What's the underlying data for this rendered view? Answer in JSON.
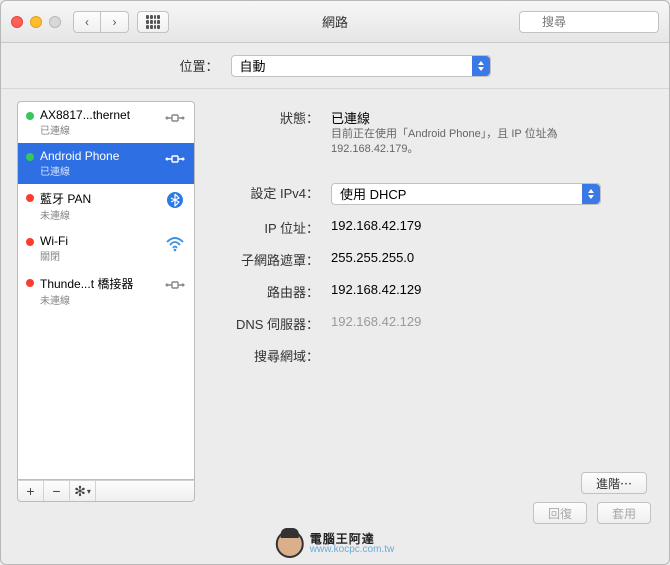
{
  "window": {
    "title": "網路"
  },
  "toolbar": {
    "search_placeholder": "搜尋"
  },
  "location": {
    "label": "位置：",
    "value": "自動"
  },
  "sidebar": {
    "items": [
      {
        "name": "AX8817...thernet",
        "status": "已連線",
        "dot": "green",
        "icon": "link"
      },
      {
        "name": "Android Phone",
        "status": "已連線",
        "dot": "green",
        "icon": "link"
      },
      {
        "name": "藍牙 PAN",
        "status": "未連線",
        "dot": "red",
        "icon": "bluetooth"
      },
      {
        "name": "Wi-Fi",
        "status": "關閉",
        "dot": "red",
        "icon": "wifi"
      },
      {
        "name": "Thunde...t 橋接器",
        "status": "未連線",
        "dot": "red",
        "icon": "link"
      }
    ],
    "buttons": {
      "add": "+",
      "remove": "−",
      "gear": "✻"
    }
  },
  "detail": {
    "status_label": "狀態：",
    "status_value": "已連線",
    "status_desc": "目前正在使用「Android Phone」，且 IP 位址為 192.168.42.179。",
    "ipv4_label": "設定 IPv4：",
    "ipv4_value": "使用 DHCP",
    "ip_label": "IP 位址：",
    "ip_value": "192.168.42.179",
    "mask_label": "子網路遮罩：",
    "mask_value": "255.255.255.0",
    "router_label": "路由器：",
    "router_value": "192.168.42.129",
    "dns_label": "DNS 伺服器：",
    "dns_value": "192.168.42.129",
    "search_label": "搜尋網域："
  },
  "buttons": {
    "advanced": "進階⋯",
    "revert": "回復",
    "apply": "套用"
  },
  "watermark": {
    "text": "電腦王阿達",
    "url": "www.kocpc.com.tw"
  }
}
